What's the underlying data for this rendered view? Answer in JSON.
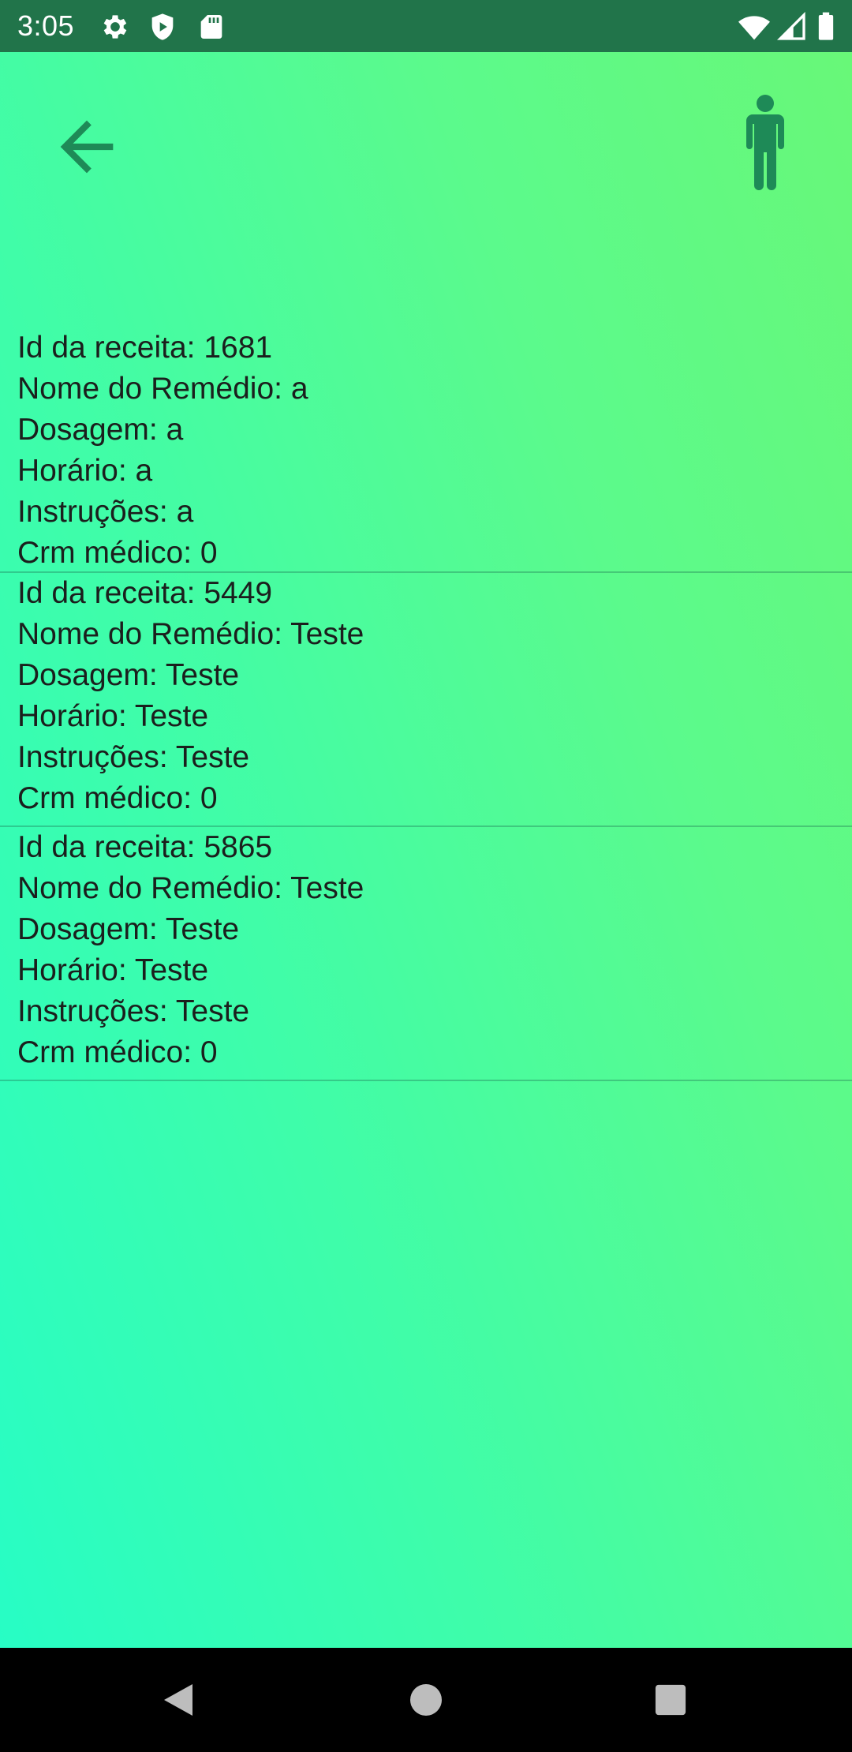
{
  "status_bar": {
    "time": "3:05",
    "icons_left": [
      "gear-icon",
      "shield-play-icon",
      "sd-card-icon"
    ],
    "icons_right": [
      "wifi-icon",
      "signal-icon",
      "battery-icon"
    ]
  },
  "header": {
    "back_icon": "arrow-back-icon",
    "profile_icon": "person-icon",
    "icon_color": "#1e8a57"
  },
  "prescriptions": [
    {
      "id_label": "Id da receita: ",
      "id": "1681",
      "medicine_label": "Nome do Remédio: ",
      "medicine": "a",
      "dosage_label": "Dosagem: ",
      "dosage": "a",
      "schedule_label": "Horário: ",
      "schedule": "a",
      "instructions_label": "Instruções: ",
      "instructions": "a",
      "crm_label": "Crm médico: ",
      "crm": "0"
    },
    {
      "id_label": "Id da receita: ",
      "id": "5449",
      "medicine_label": "Nome do Remédio: ",
      "medicine": "Teste",
      "dosage_label": "Dosagem: ",
      "dosage": "Teste",
      "schedule_label": "Horário: ",
      "schedule": "Teste",
      "instructions_label": "Instruções: ",
      "instructions": "Teste",
      "crm_label": "Crm médico: ",
      "crm": "0"
    },
    {
      "id_label": "Id da receita: ",
      "id": "5865",
      "medicine_label": "Nome do Remédio: ",
      "medicine": "Teste",
      "dosage_label": "Dosagem: ",
      "dosage": "Teste",
      "schedule_label": "Horário: ",
      "schedule": "Teste",
      "instructions_label": "Instruções: ",
      "instructions": "Teste",
      "crm_label": "Crm médico: ",
      "crm": "0"
    }
  ],
  "nav_bar": {
    "back": "nav-back-icon",
    "home": "nav-home-icon",
    "recents": "nav-recents-icon"
  },
  "colors": {
    "status_bar": "#21744a",
    "gradient_start": "#27fdc5",
    "gradient_end": "#68f878",
    "divider": "#3f9c74",
    "text": "#1b1f1d"
  }
}
